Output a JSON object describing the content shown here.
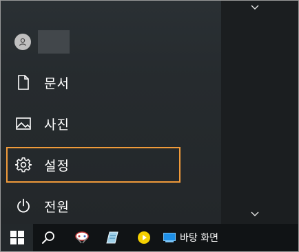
{
  "start_menu": {
    "items": [
      {
        "label": "문서",
        "icon": "document-icon"
      },
      {
        "label": "사진",
        "icon": "pictures-icon"
      },
      {
        "label": "설정",
        "icon": "gear-icon",
        "selected": true
      },
      {
        "label": "전원",
        "icon": "power-icon"
      }
    ]
  },
  "taskbar": {
    "desktop_label": "바탕 화면"
  },
  "colors": {
    "highlight": "#f09a3a",
    "taskbar": "#101315",
    "accent_blue": "#1e90e8",
    "media_yellow": "#f5d000"
  }
}
